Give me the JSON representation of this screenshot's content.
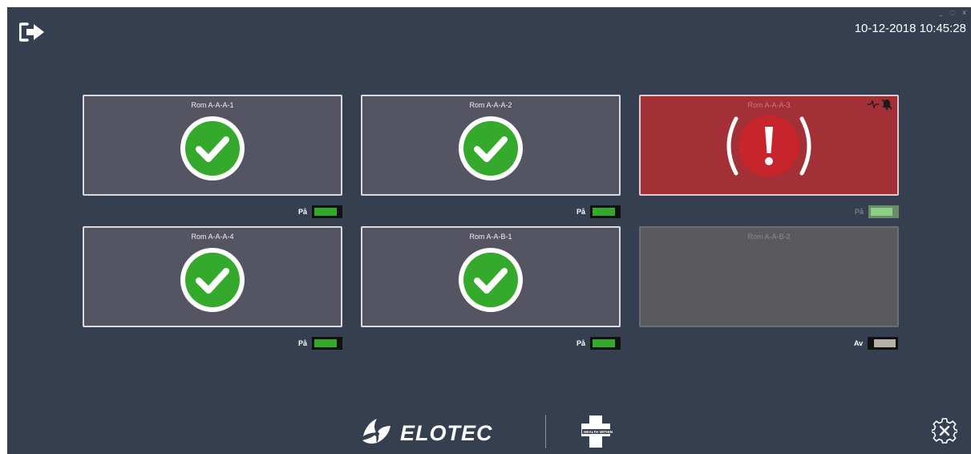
{
  "header": {
    "datetime": "10-12-2018 10:45:28",
    "exit_icon": "exit-door-icon",
    "window_controls": [
      "_",
      "◌",
      "x"
    ]
  },
  "rooms": [
    {
      "name": "Rom A-A-A-1",
      "status": "ok",
      "toggle_label": "På",
      "toggle_state": "on"
    },
    {
      "name": "Rom A-A-A-2",
      "status": "ok",
      "toggle_label": "På",
      "toggle_state": "on"
    },
    {
      "name": "Rom A-A-A-3",
      "status": "alarm",
      "toggle_label": "På",
      "toggle_state": "on"
    },
    {
      "name": "Rom A-A-A-4",
      "status": "ok",
      "toggle_label": "På",
      "toggle_state": "on"
    },
    {
      "name": "Rom A-A-B-1",
      "status": "ok",
      "toggle_label": "På",
      "toggle_state": "on"
    },
    {
      "name": "Rom A-A-B-2",
      "status": "off",
      "toggle_label": "Av",
      "toggle_state": "off"
    }
  ],
  "footer": {
    "brand": "ELOTEC",
    "partner_text": "HEALTH WITHIN",
    "settings_icon": "settings-gear-icon"
  },
  "colors": {
    "background": "#353f50",
    "tile": "#555463",
    "alarm": "#a33036",
    "ok_green": "#35a92b",
    "off_tile": "#5a5a5e"
  }
}
